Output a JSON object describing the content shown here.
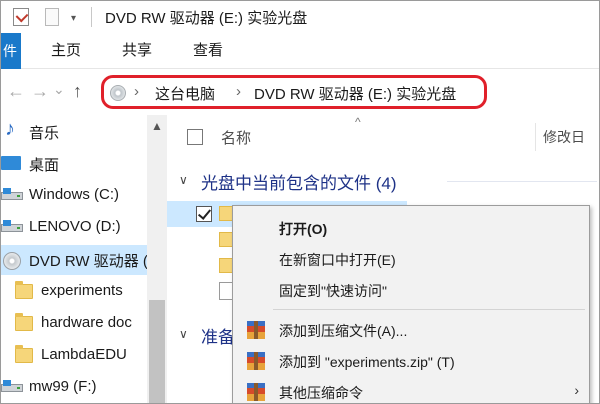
{
  "window": {
    "title": "DVD RW 驱动器 (E:) 实验光盘",
    "quick_access_dropdown": "▾"
  },
  "ribbon": {
    "file_tab": "件",
    "tabs": [
      "主页",
      "共享",
      "查看"
    ]
  },
  "nav": {
    "back": "←",
    "forward": "→",
    "recent": "⌄",
    "up": "↑",
    "breadcrumbs": [
      "这台电脑",
      "DVD RW 驱动器 (E:) 实验光盘"
    ],
    "separator": "›"
  },
  "sidebar": {
    "items": [
      {
        "label": "音乐",
        "icon": "music-icon"
      },
      {
        "label": "桌面",
        "icon": "desktop-icon"
      },
      {
        "label": "Windows (C:)",
        "icon": "drive-icon"
      },
      {
        "label": "LENOVO (D:)",
        "icon": "drive-icon"
      },
      {
        "label": "DVD RW 驱动器 (E:)",
        "icon": "dvd-icon",
        "selected": true
      },
      {
        "label": "experiments",
        "icon": "folder-icon"
      },
      {
        "label": "hardware doc",
        "icon": "folder-icon"
      },
      {
        "label": "LambdaEDU",
        "icon": "folder-icon"
      },
      {
        "label": "mw99 (F:)",
        "icon": "drive-icon"
      }
    ],
    "scroll_up": "▲"
  },
  "content": {
    "sort_indicator": "^",
    "columns": {
      "name": "名称",
      "modified": "修改日"
    },
    "group_title": "光盘中当前包含的文件 (4)",
    "group_collapse": "∨",
    "group2_title": "准备",
    "files": [
      {
        "checked": true,
        "selected": true,
        "icon": "folder-icon"
      },
      {
        "checked": false,
        "selected": false,
        "icon": "folder-icon"
      },
      {
        "checked": false,
        "selected": false,
        "icon": "folder-icon"
      },
      {
        "checked": false,
        "selected": false,
        "icon": "document-icon"
      }
    ]
  },
  "context_menu": {
    "items": [
      {
        "label": "打开(O)",
        "bold": true
      },
      {
        "label": "在新窗口中打开(E)"
      },
      {
        "label": "固定到\"快速访问\""
      },
      {
        "label": "添加到压缩文件(A)...",
        "icon": "winrar-icon"
      },
      {
        "label": "添加到 \"experiments.zip\" (T)",
        "icon": "winrar-icon"
      },
      {
        "label": "其他压缩命令",
        "icon": "winrar-icon",
        "submenu": "›"
      }
    ]
  },
  "colors": {
    "accent": "#1979ca",
    "selection": "#cce8ff",
    "address_highlight": "#e0202a",
    "group_title": "#1e3287"
  }
}
